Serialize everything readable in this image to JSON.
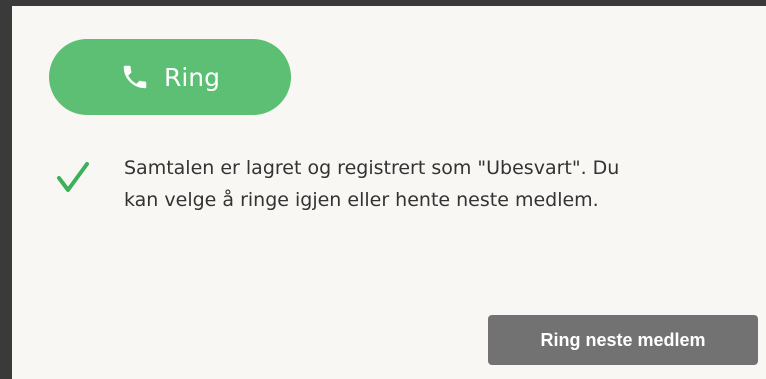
{
  "call_button": {
    "label": "Ring",
    "icon": "phone-icon",
    "color": "#5cbf73"
  },
  "status": {
    "icon": "checkmark-icon",
    "icon_color": "#3cb05a",
    "message": "Samtalen er lagret og registrert som \"Ubesvart\". Du\nkan velge å ringe igjen eller hente neste medlem."
  },
  "next_button": {
    "label": "Ring neste medlem",
    "color": "#727272"
  }
}
